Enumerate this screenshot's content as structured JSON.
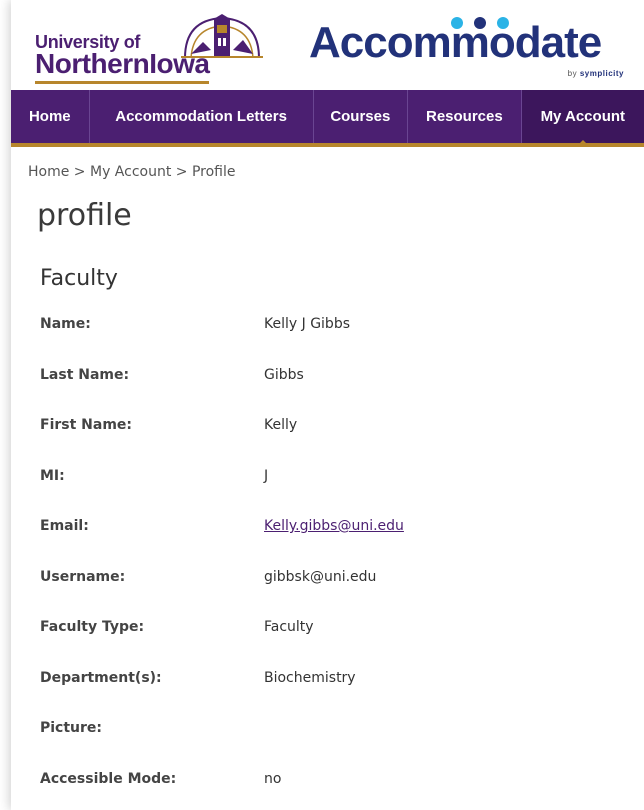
{
  "header": {
    "university": {
      "line1": "University of",
      "line2": "NorthernIowa"
    },
    "product": {
      "name": "Accommodate",
      "by": "by",
      "vendor": "symplicity"
    },
    "colors": {
      "purple": "#4b1f71",
      "gold": "#b7862c",
      "navy": "#22327a",
      "cyan": "#2bb3e6"
    }
  },
  "nav": {
    "items": [
      {
        "label": "Home"
      },
      {
        "label": "Accommodation Letters"
      },
      {
        "label": "Courses"
      },
      {
        "label": "Resources"
      },
      {
        "label": "My Account",
        "active": true
      }
    ]
  },
  "breadcrumb": {
    "items": [
      "Home",
      "My Account",
      "Profile"
    ],
    "separator": ">"
  },
  "page": {
    "title": "profile",
    "section_title": "Faculty"
  },
  "profile": {
    "fields": [
      {
        "label": "Name:",
        "value": "Kelly J Gibbs"
      },
      {
        "label": "Last Name:",
        "value": "Gibbs"
      },
      {
        "label": "First Name:",
        "value": "Kelly"
      },
      {
        "label": "MI:",
        "value": "J"
      },
      {
        "label": "Email:",
        "value": "Kelly.gibbs@uni.edu",
        "link": true
      },
      {
        "label": "Username:",
        "value": "gibbsk@uni.edu"
      },
      {
        "label": "Faculty Type:",
        "value": "Faculty"
      },
      {
        "label": "Department(s):",
        "value": "Biochemistry"
      },
      {
        "label": "Picture:",
        "value": ""
      },
      {
        "label": "Accessible Mode:",
        "value": "no"
      }
    ]
  }
}
